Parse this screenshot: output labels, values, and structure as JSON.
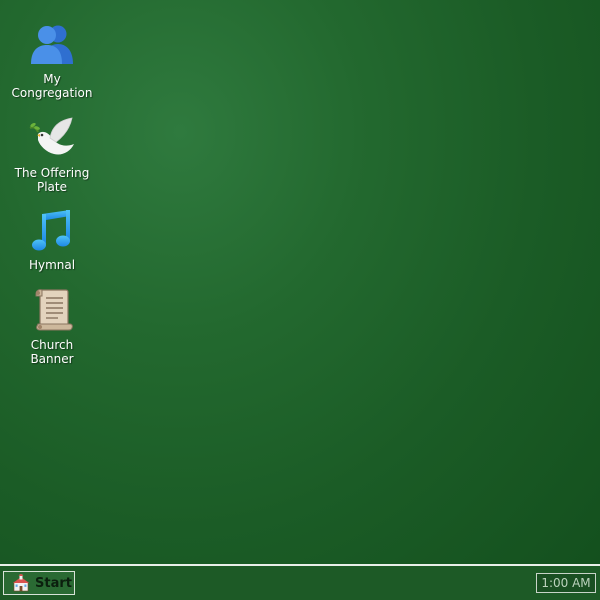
{
  "desktop": {
    "background_color": "#1d5f28",
    "icons": [
      {
        "label": "My\nCongregation",
        "icon": "users-icon"
      },
      {
        "label": "The Offering\nPlate",
        "icon": "dove-icon"
      },
      {
        "label": "Hymnal",
        "icon": "music-note-icon"
      },
      {
        "label": "Church\nBanner",
        "icon": "scroll-icon"
      }
    ]
  },
  "taskbar": {
    "start_label": "Start",
    "start_icon": "church-icon",
    "clock": "1:00 AM"
  }
}
